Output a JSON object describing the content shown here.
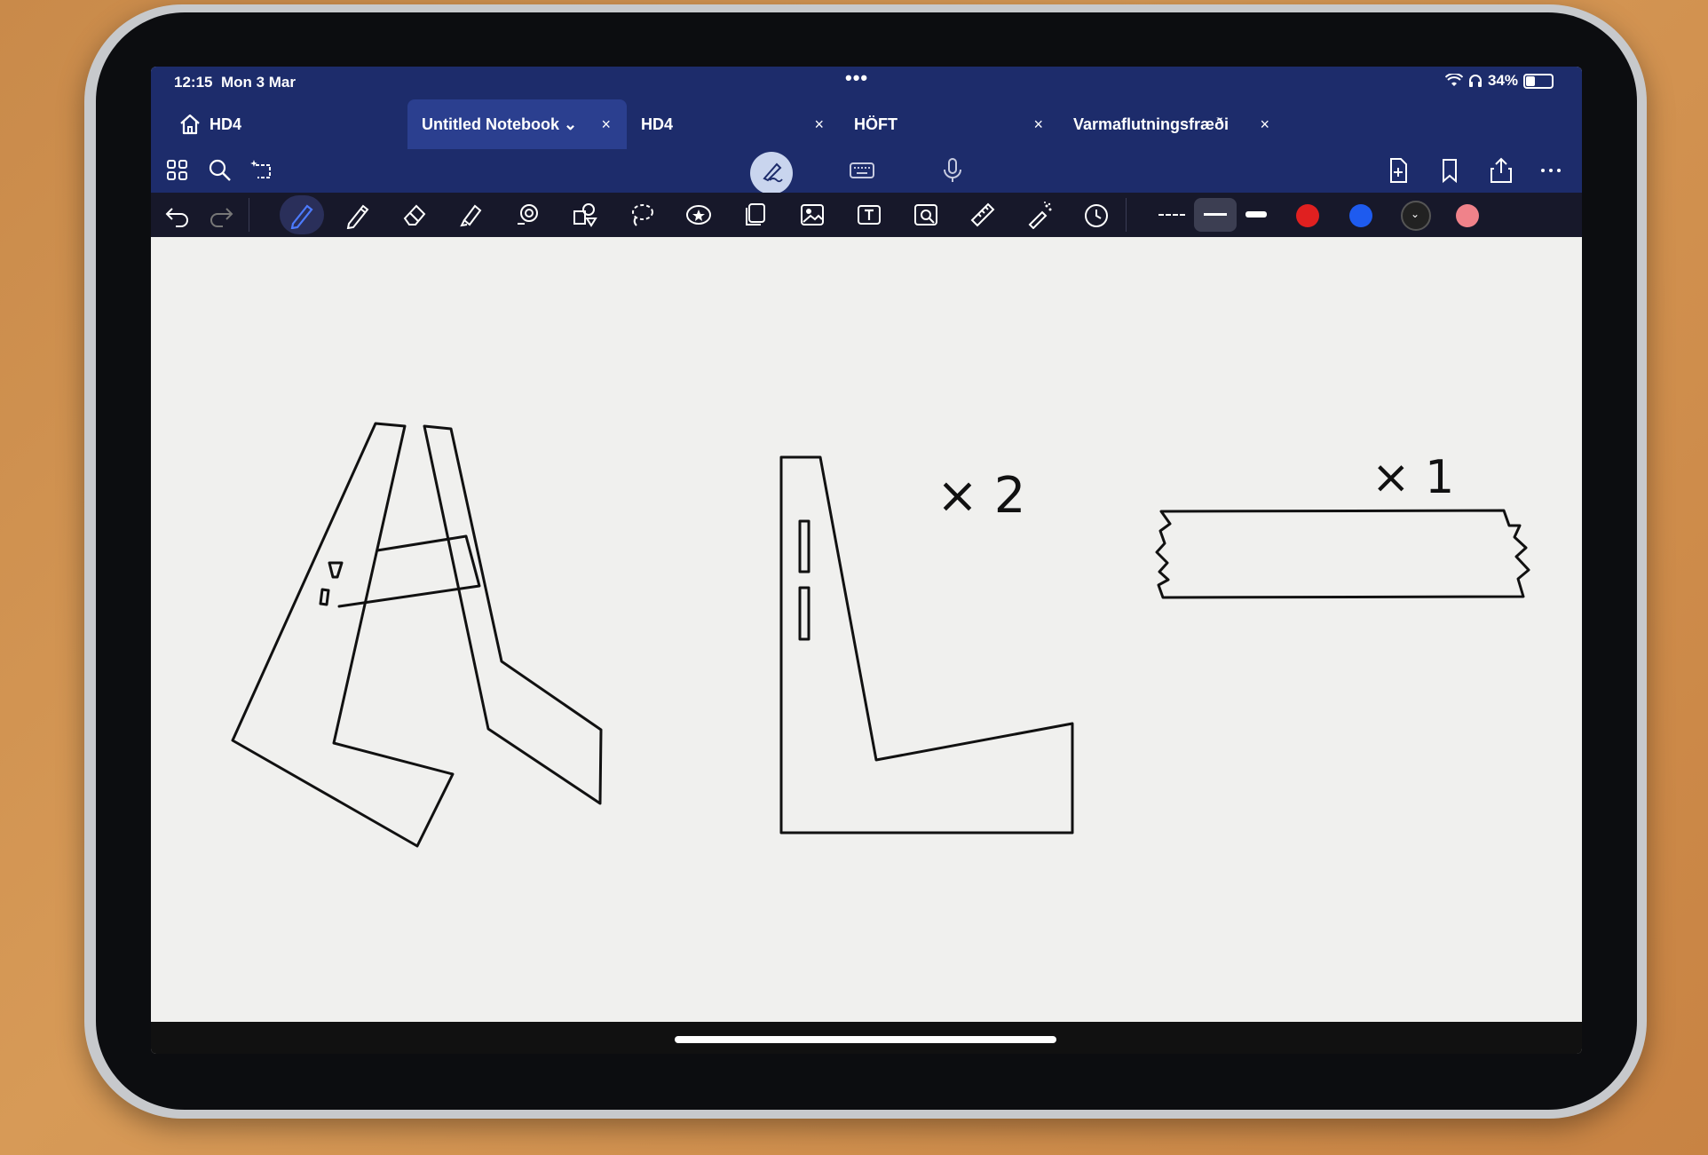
{
  "status": {
    "time": "12:15",
    "date": "Mon 3 Mar",
    "battery": "34%",
    "battery_level": 0.34
  },
  "tabs": [
    {
      "label": "HD4",
      "close": "×",
      "active": false
    },
    {
      "label": "Untitled Notebook",
      "close": "×",
      "active": true,
      "dropdown": "⌄"
    },
    {
      "label": "HD4",
      "close": "×",
      "active": false
    },
    {
      "label": "HÖFT",
      "close": "×",
      "active": false
    },
    {
      "label": "Varmaflutningsfræði",
      "close": "×",
      "active": false
    }
  ],
  "toolbar_top": {
    "left_icons": [
      "grid-icon",
      "search-icon",
      "lasso-sparkle-icon"
    ],
    "center_icons": [
      "pen-mode-icon",
      "keyboard-icon",
      "microphone-icon"
    ],
    "right_icons": [
      "add-page-icon",
      "bookmark-icon",
      "share-icon",
      "more-icon"
    ]
  },
  "toolbar_tools": {
    "tools": [
      "undo-icon",
      "redo-icon",
      "pen-icon",
      "pencil-icon",
      "eraser-icon",
      "highlighter-icon",
      "shape-icon",
      "elements-icon",
      "lasso-icon",
      "sticker-icon",
      "page-icon",
      "image-icon",
      "text-icon",
      "camera-icon",
      "ruler-icon",
      "laser-icon",
      "timer-icon"
    ],
    "line_styles": [
      "dashed",
      "thin",
      "thick"
    ],
    "colors": [
      "#e02020",
      "#1e5bef",
      "#222222",
      "#f0828a"
    ]
  },
  "canvas": {
    "annotation_1": "× 2",
    "annotation_2": "× 1"
  },
  "colors": {
    "header": "#1d2c6b",
    "active_tab": "#2b3f8f",
    "tool_bar": "#17182a",
    "paper": "#f0f0ee"
  }
}
